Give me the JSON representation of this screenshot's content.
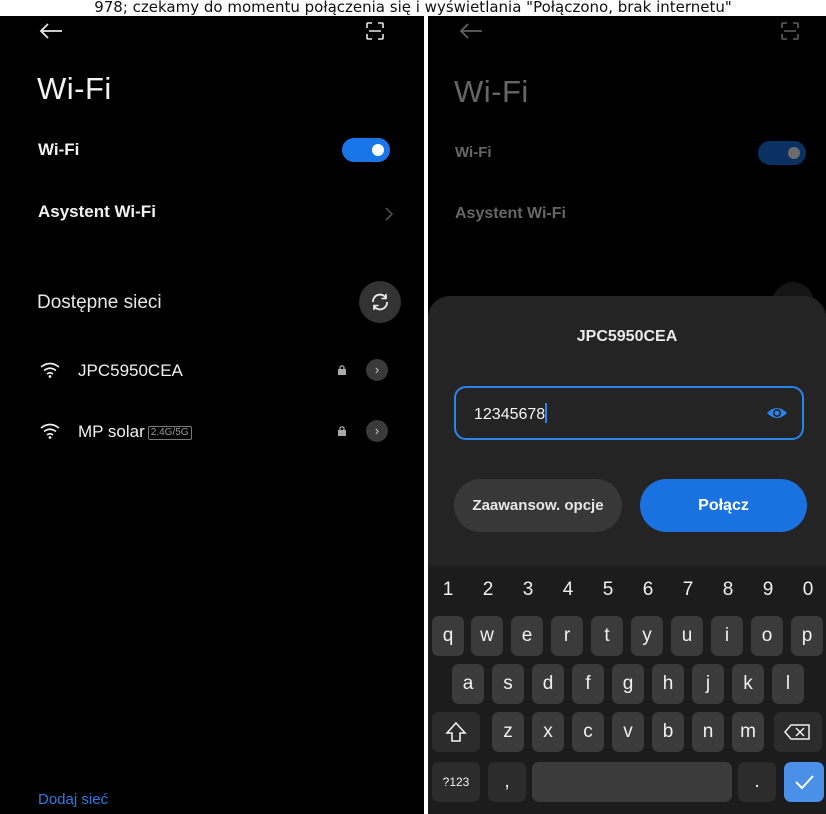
{
  "caption": "978; czekamy do momentu połączenia się i wyświetlania \"Połączono, brak internetu\"",
  "left": {
    "title": "Wi-Fi",
    "wifi_label": "Wi-Fi",
    "wifi_toggle": "on",
    "assistant_label": "Asystent Wi-Fi",
    "section_label": "Dostępne sieci",
    "networks": [
      {
        "name": "JPC5950CEA",
        "badge": "",
        "locked": true
      },
      {
        "name": "MP solar",
        "badge": "2.4G/5G",
        "locked": true
      }
    ],
    "add_network": "Dodaj sieć"
  },
  "right": {
    "title": "Wi-Fi",
    "wifi_label": "Wi-Fi",
    "assistant_label": "Asystent Wi-Fi",
    "dialog": {
      "title": "JPC5950CEA",
      "password": "12345678",
      "advanced_button": "Zaawansow. opcje",
      "connect_button": "Połącz"
    },
    "keyboard": {
      "numbers": [
        "1",
        "2",
        "3",
        "4",
        "5",
        "6",
        "7",
        "8",
        "9",
        "0"
      ],
      "row1": [
        "q",
        "w",
        "e",
        "r",
        "t",
        "y",
        "u",
        "i",
        "o",
        "p"
      ],
      "row2": [
        "a",
        "s",
        "d",
        "f",
        "g",
        "h",
        "j",
        "k",
        "l"
      ],
      "row3": [
        "z",
        "x",
        "c",
        "v",
        "b",
        "n",
        "m"
      ],
      "symbols_key": "?123",
      "comma_key": ",",
      "period_key": "."
    }
  },
  "colors": {
    "accent": "#1976e8",
    "background": "#000000",
    "dialog": "#242424"
  },
  "icons": [
    "back-arrow-icon",
    "scan-icon",
    "wifi-icon",
    "lock-icon",
    "chevron-right-icon",
    "refresh-icon",
    "eye-icon",
    "shift-icon",
    "backspace-icon",
    "check-icon"
  ]
}
